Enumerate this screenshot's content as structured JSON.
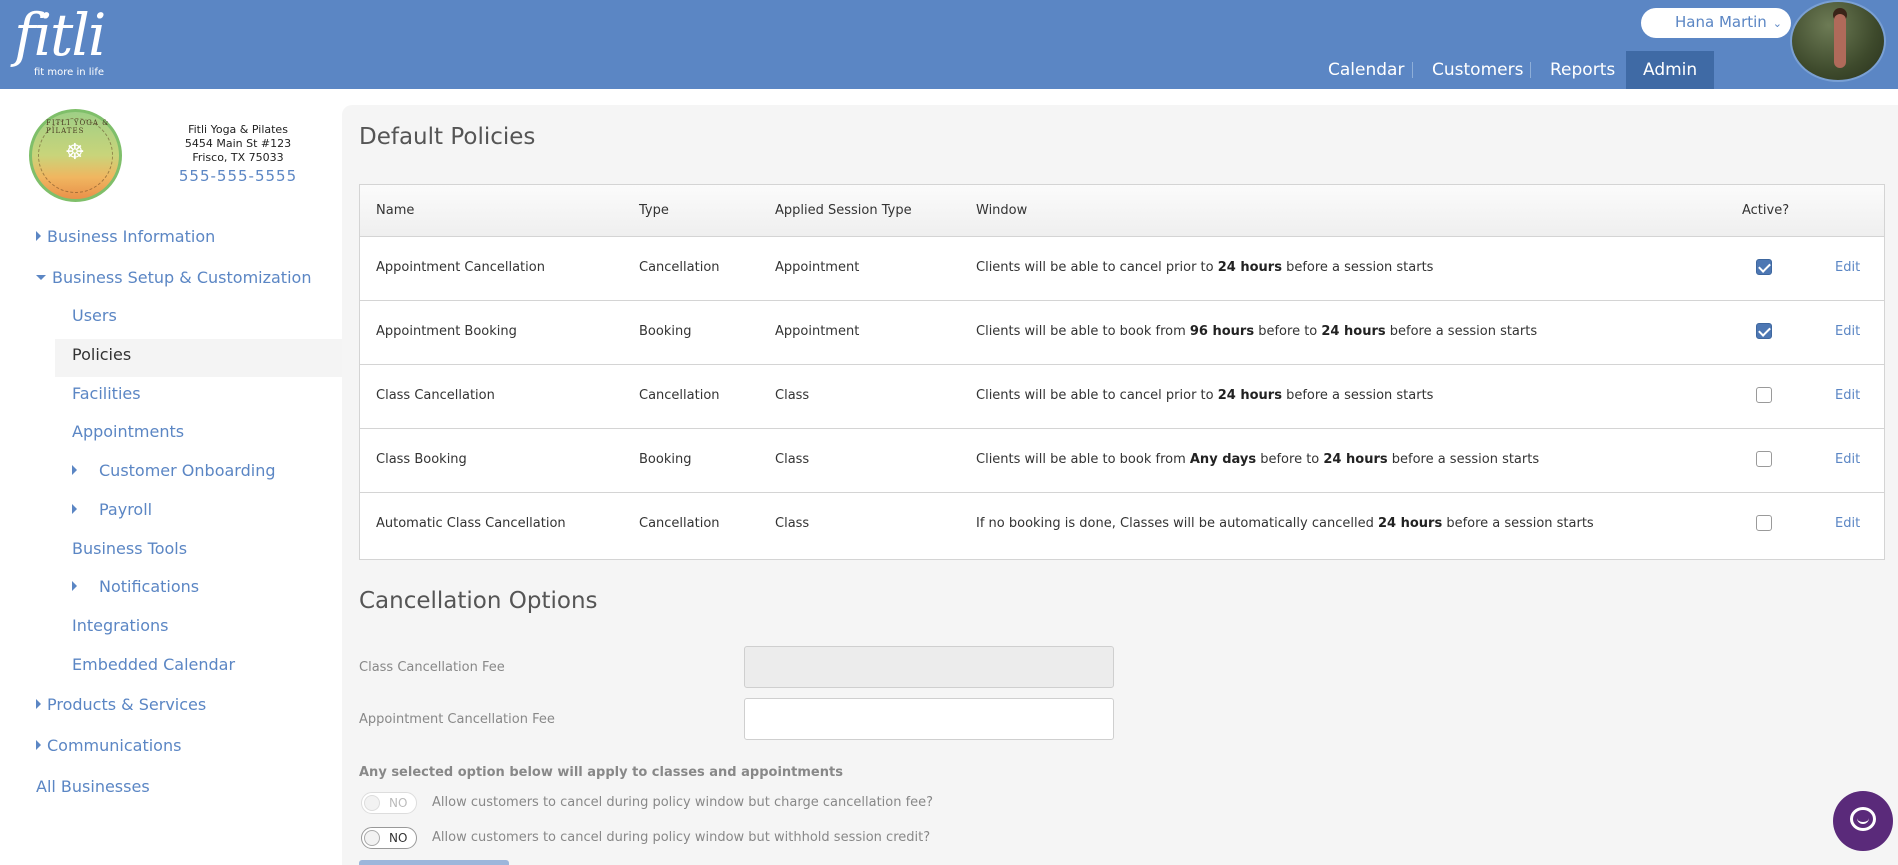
{
  "header": {
    "logo_word": "fitli",
    "logo_tagline": "fit more in life",
    "user_name": "Hana Martin",
    "nav": [
      {
        "label": "Calendar"
      },
      {
        "label": "Customers"
      },
      {
        "label": "Reports"
      },
      {
        "label": "Admin",
        "active": true
      }
    ]
  },
  "business": {
    "name": "Fitli Yoga & Pilates",
    "address_line1": "5454 Main St #123",
    "address_line2": "Frisco, TX 75033",
    "phone": "555-555-5555",
    "logo_ring_text": "FITLI YOGA & PILATES"
  },
  "sidebar": {
    "items": [
      {
        "label": "Business Information",
        "expander": "collapsed"
      },
      {
        "label": "Business Setup & Customization",
        "expander": "expanded"
      },
      {
        "label": "Users"
      },
      {
        "label": "Policies",
        "active": true
      },
      {
        "label": "Facilities"
      },
      {
        "label": "Appointments"
      },
      {
        "label": "Customer Onboarding",
        "expander": "collapsed"
      },
      {
        "label": "Payroll",
        "expander": "collapsed"
      },
      {
        "label": "Business Tools"
      },
      {
        "label": "Notifications",
        "expander": "collapsed"
      },
      {
        "label": "Integrations"
      },
      {
        "label": "Embedded Calendar"
      },
      {
        "label": "Products & Services",
        "expander": "collapsed"
      },
      {
        "label": "Communications",
        "expander": "collapsed"
      },
      {
        "label": "All Businesses"
      }
    ]
  },
  "policies": {
    "title": "Default Policies",
    "columns": {
      "name": "Name",
      "type": "Type",
      "session_type": "Applied Session Type",
      "window": "Window",
      "active": "Active?"
    },
    "edit_label": "Edit",
    "rows": [
      {
        "name": "Appointment Cancellation",
        "type": "Cancellation",
        "session_type": "Appointment",
        "w1": "Clients will be able to cancel prior to ",
        "b1": "24 hours",
        "w2": " before a session starts",
        "b2": "",
        "w3": "",
        "active": true
      },
      {
        "name": "Appointment Booking",
        "type": "Booking",
        "session_type": "Appointment",
        "w1": "Clients will be able to book from ",
        "b1": "96 hours",
        "w2": " before to ",
        "b2": "24 hours",
        "w3": " before a session starts",
        "active": true
      },
      {
        "name": "Class Cancellation",
        "type": "Cancellation",
        "session_type": "Class",
        "w1": "Clients will be able to cancel prior to ",
        "b1": "24 hours",
        "w2": " before a session starts",
        "b2": "",
        "w3": "",
        "active": false
      },
      {
        "name": "Class Booking",
        "type": "Booking",
        "session_type": "Class",
        "w1": "Clients will be able to book from ",
        "b1": "Any days",
        "w2": " before to ",
        "b2": "24 hours",
        "w3": " before a session starts",
        "active": false
      },
      {
        "name": "Automatic Class Cancellation",
        "type": "Cancellation",
        "session_type": "Class",
        "w1": "If no booking is done, Classes will be automatically cancelled ",
        "b1": "24 hours",
        "w2": " before a session starts",
        "b2": "",
        "w3": "",
        "active": false
      }
    ]
  },
  "cancellation": {
    "title": "Cancellation Options",
    "class_fee_label": "Class Cancellation Fee",
    "class_fee_value": "",
    "appointment_fee_label": "Appointment Cancellation Fee",
    "appointment_fee_value": "",
    "note": "Any selected option below will apply to classes and appointments",
    "options": [
      {
        "toggle": "NO",
        "label": "Allow customers to cancel during policy window but charge cancellation fee?",
        "disabled": true
      },
      {
        "toggle": "NO",
        "label": "Allow customers to cancel during policy window but withhold session credit?",
        "disabled": false
      }
    ]
  },
  "colors": {
    "brand": "#5b86c4",
    "nav_active": "#3f6aa5",
    "chat": "#5a2a7a"
  }
}
